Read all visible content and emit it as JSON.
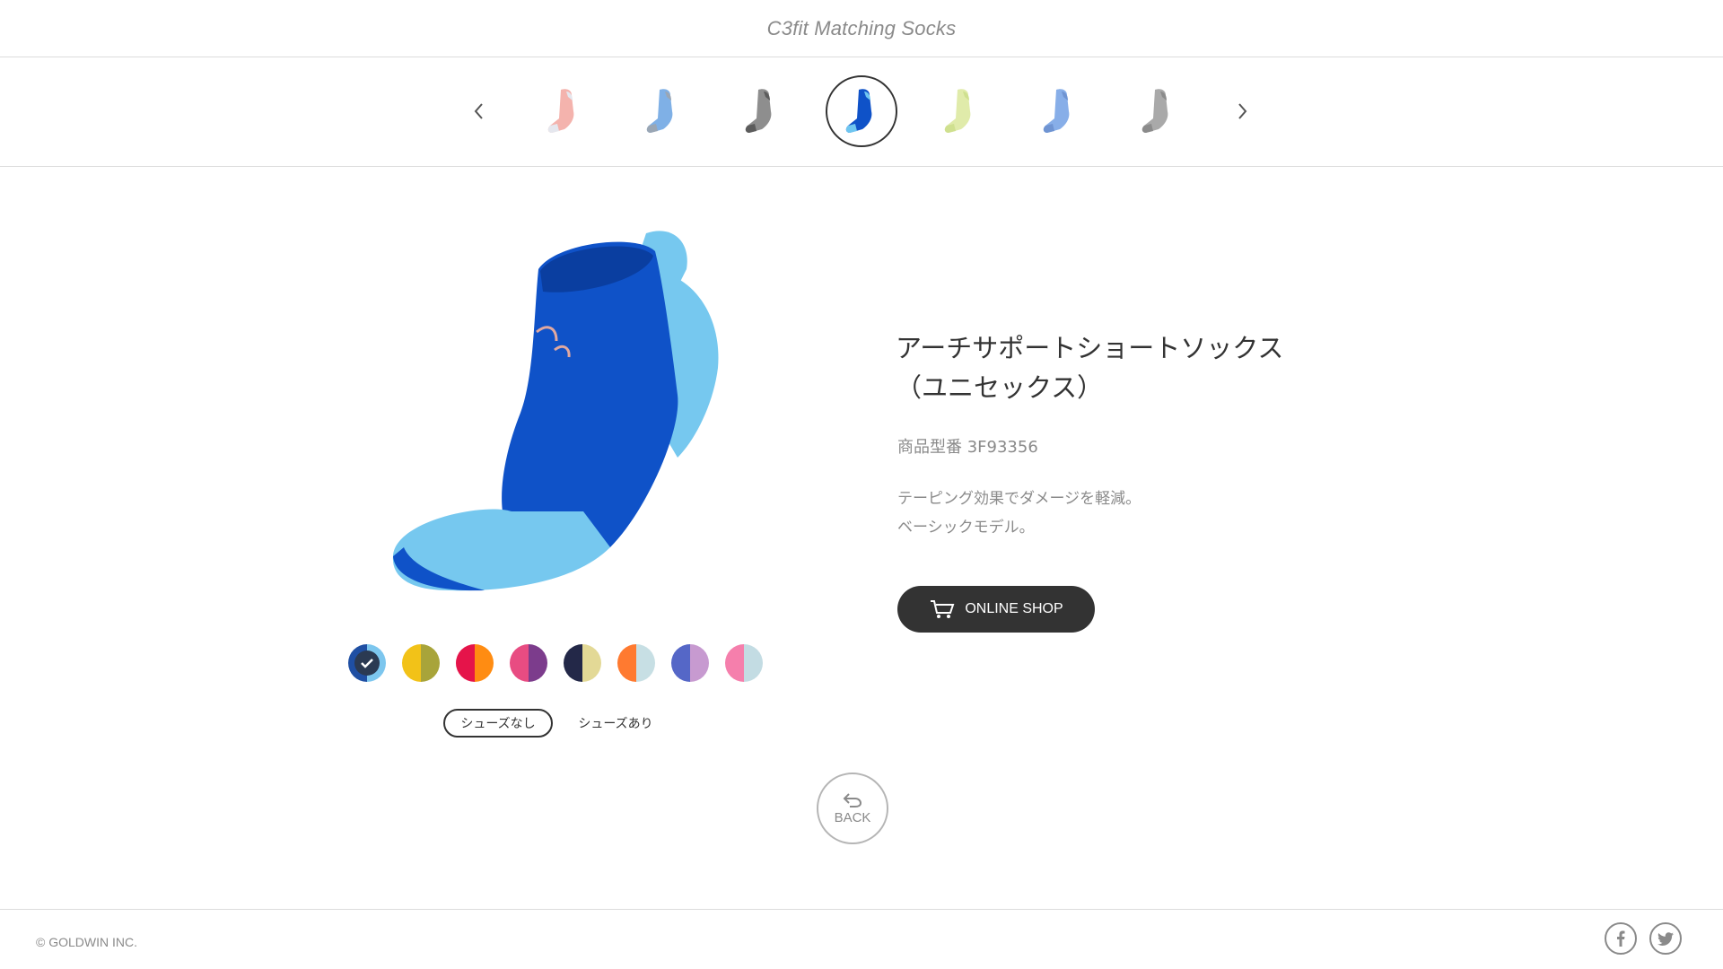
{
  "header": {
    "title": "C3fit Matching Socks"
  },
  "carousel": {
    "prev_icon": "chevron-left-icon",
    "next_icon": "chevron-right-icon",
    "items": [
      {
        "name": "sock-pink",
        "colors": [
          "#f4b3ad",
          "#e5e7ee"
        ]
      },
      {
        "name": "sock-lightblue",
        "colors": [
          "#7fb0e6",
          "#9aa6b4"
        ]
      },
      {
        "name": "sock-gray",
        "colors": [
          "#8e8e8e",
          "#5c5c5c"
        ]
      },
      {
        "name": "sock-blue",
        "colors": [
          "#0f52c8",
          "#6fc6f0"
        ],
        "active": true
      },
      {
        "name": "sock-lime",
        "colors": [
          "#e0ebaa",
          "#cfe08f"
        ]
      },
      {
        "name": "sock-periwinkle",
        "colors": [
          "#87aee8",
          "#6f94d2"
        ]
      },
      {
        "name": "sock-lightgray",
        "colors": [
          "#a9a9a9",
          "#8b8b8b"
        ]
      }
    ]
  },
  "product": {
    "title_line1": "アーチサポートショートソックス",
    "title_line2": "（ユニセックス）",
    "number": "商品型番 3F93356",
    "desc_line1": "テーピング効果でダメージを軽減。",
    "desc_line2": "ベーシックモデル。",
    "online_shop_label": "ONLINE SHOP",
    "main_colors": {
      "body": "#0f52c8",
      "accent": "#76c8ef"
    }
  },
  "swatches": [
    {
      "left": "#1f4fa3",
      "right": "#7cc6ee",
      "selected": true
    },
    {
      "left": "#f2c218",
      "right": "#a8a43a"
    },
    {
      "left": "#e5144a",
      "right": "#ff8c12"
    },
    {
      "left": "#e84c82",
      "right": "#7c3c8c"
    },
    {
      "left": "#232848",
      "right": "#e3d996"
    },
    {
      "left": "#ff7a30",
      "right": "#c7dfe4"
    },
    {
      "left": "#5567c7",
      "right": "#c79ad0"
    },
    {
      "left": "#f57fac",
      "right": "#c3dce3"
    }
  ],
  "toggles": {
    "without_shoes": "シューズなし",
    "with_shoes": "シューズあり"
  },
  "back": {
    "label": "BACK"
  },
  "footer": {
    "copyright": "© GOLDWIN INC.",
    "facebook_icon": "facebook-icon",
    "twitter_icon": "twitter-icon"
  }
}
